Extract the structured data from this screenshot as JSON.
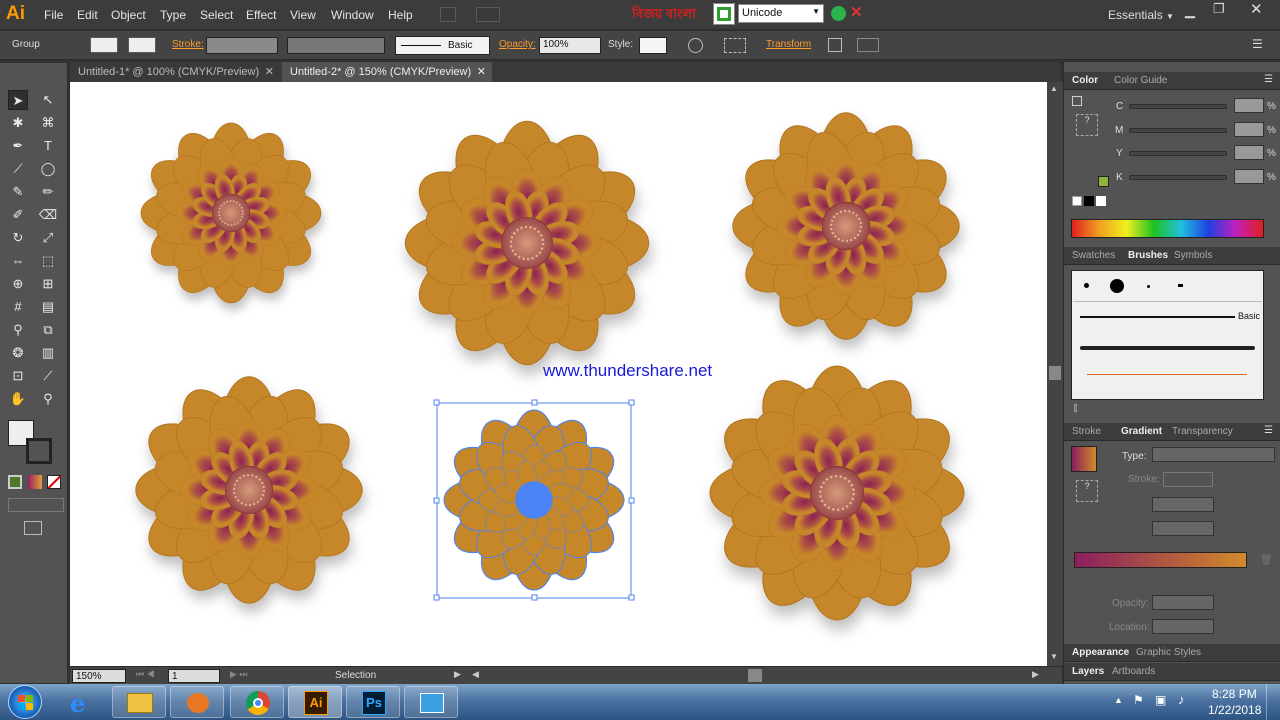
{
  "app": {
    "logo": "Ai"
  },
  "menu": [
    "File",
    "Edit",
    "Object",
    "Type",
    "Select",
    "Effect",
    "View",
    "Window",
    "Help"
  ],
  "bengali_kbd": {
    "label": "বিজয় বাংলা",
    "input_mode": "Unicode"
  },
  "workspace": "Essentials",
  "control_bar": {
    "selection_label": "Group",
    "stroke_label": "Stroke:",
    "stroke_profile": "Basic",
    "opacity_label": "Opacity:",
    "opacity_value": "100%",
    "style_label": "Style:",
    "transform_label": "Transform"
  },
  "doc_tabs": [
    {
      "label": "Untitled-1* @ 100% (CMYK/Preview)",
      "active": false
    },
    {
      "label": "Untitled-2* @ 150% (CMYK/Preview)",
      "active": true
    }
  ],
  "canvas": {
    "watermark": "www.thundershare.net",
    "flower_color": "#c68729",
    "flower_center": "#b8404f",
    "selection_color": "#4b83f5"
  },
  "status": {
    "zoom": "150%",
    "artboard": "1",
    "tool": "Selection"
  },
  "color_panel": {
    "tabs": [
      "Color",
      "Color Guide"
    ],
    "channels": [
      "C",
      "M",
      "Y",
      "K"
    ],
    "unit": "%"
  },
  "brush_panel": {
    "tabs": [
      "Swatches",
      "Brushes",
      "Symbols"
    ],
    "basic_label": "Basic"
  },
  "gradient_panel": {
    "tabs": [
      "Stroke",
      "Gradient",
      "Transparency"
    ],
    "type_label": "Type:",
    "stroke_label": "Stroke:",
    "opacity_label": "Opacity:",
    "location_label": "Location:",
    "gradient_start": "#8a1e5e",
    "gradient_end": "#d28a2a"
  },
  "bottom_tabs_1": [
    "Appearance",
    "Graphic Styles"
  ],
  "bottom_tabs_2": [
    "Layers",
    "Artboards"
  ],
  "taskbar": {
    "time": "8:28 PM",
    "date": "1/22/2018",
    "ai_label": "Ai",
    "ps_label": "Ps"
  }
}
